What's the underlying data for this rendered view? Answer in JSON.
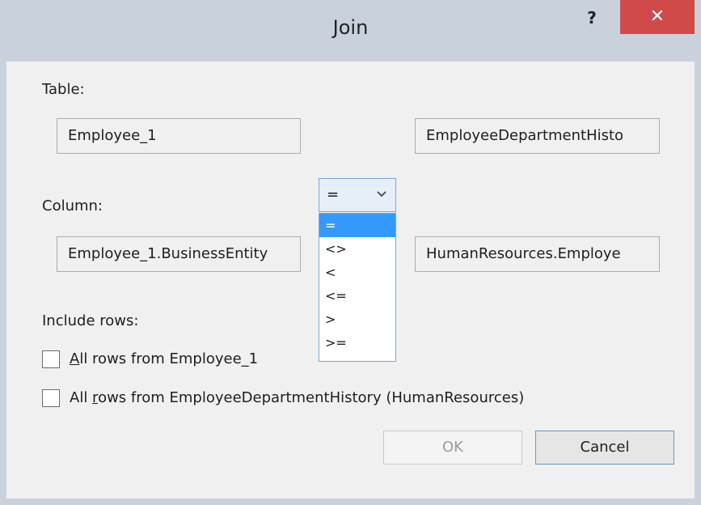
{
  "window": {
    "title": "Join",
    "help_glyph": "?",
    "close_glyph": "✕"
  },
  "table": {
    "label": "Table:",
    "left_value": "Employee_1",
    "right_value": "EmployeeDepartmentHisto"
  },
  "column": {
    "label": "Column:",
    "left_value": "Employee_1.BusinessEntity",
    "right_value": "HumanResources.Employe"
  },
  "operator": {
    "selected": "=",
    "chevron_icon": "chevron-down-icon",
    "options": [
      "=",
      "<>",
      "<",
      "<=",
      ">",
      ">="
    ]
  },
  "include_rows": {
    "label": "Include rows:",
    "option1_first": "A",
    "option1_rest": "ll rows from Employee_1",
    "option2_prefix": "All ",
    "option2_u": "r",
    "option2_rest": "ows from EmployeeDepartmentHistory (HumanResources)"
  },
  "buttons": {
    "ok": "OK",
    "cancel": "Cancel"
  },
  "colors": {
    "titlebar": "#c8d1dc",
    "close": "#d04a4a",
    "selection": "#3399ff",
    "focus_border": "#7aa7da"
  }
}
